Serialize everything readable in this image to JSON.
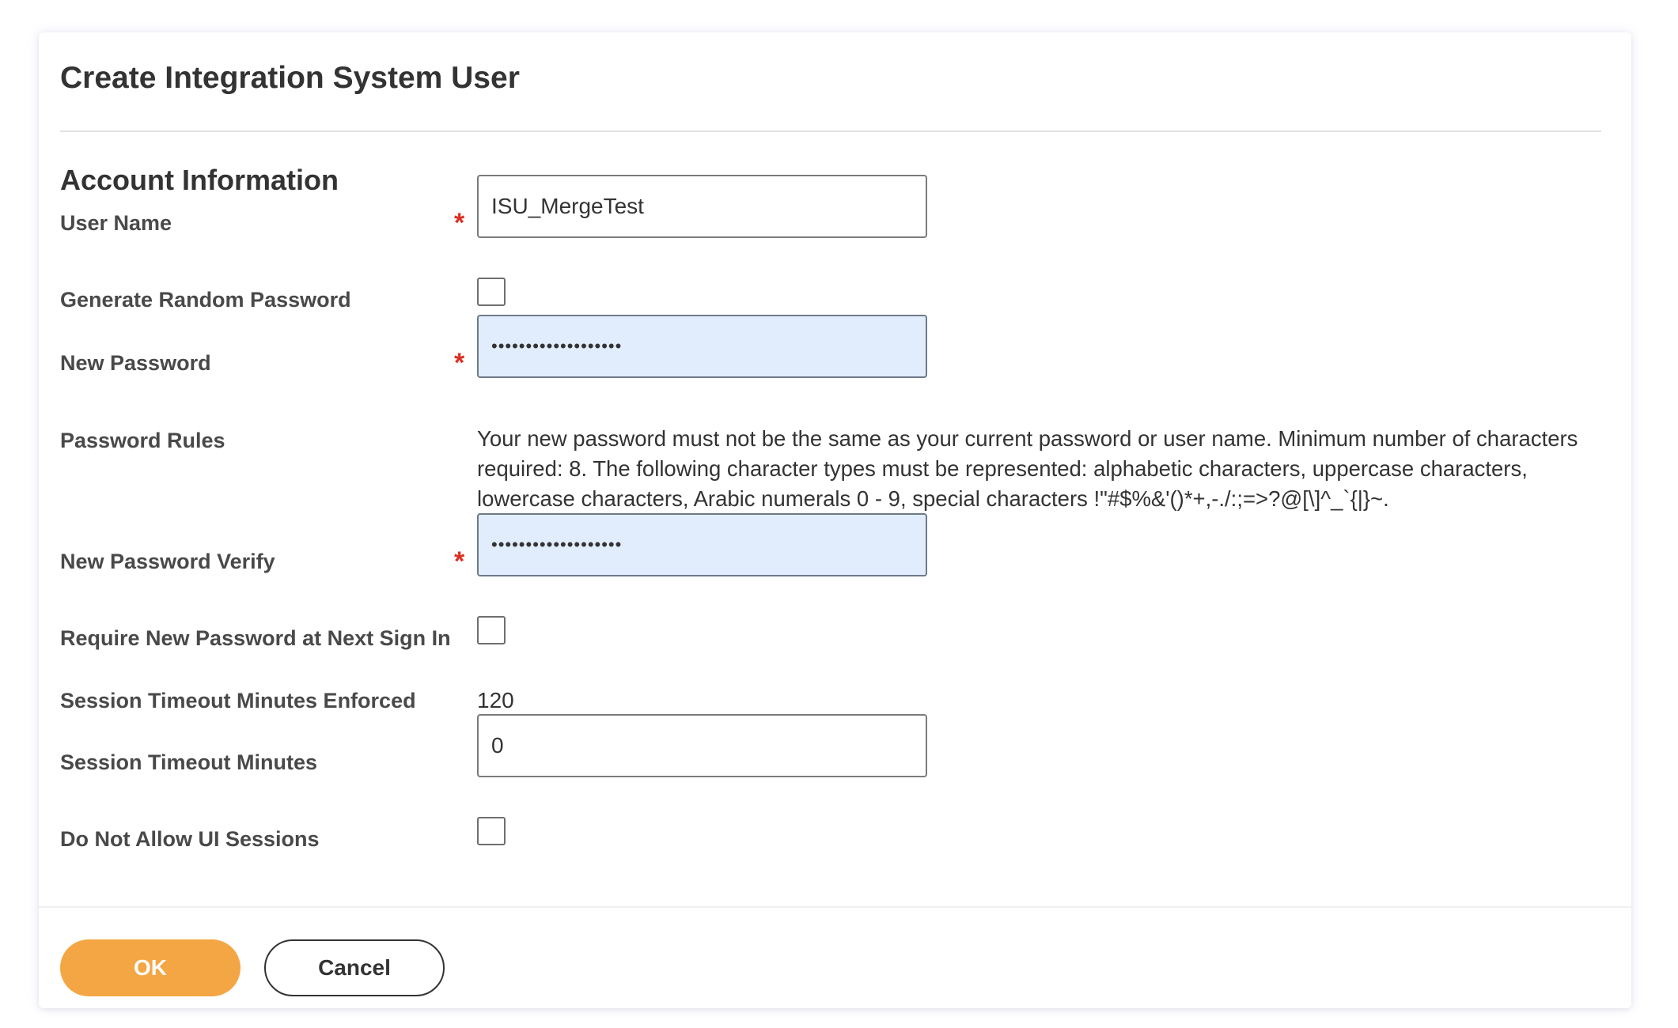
{
  "dialog": {
    "title": "Create Integration System User",
    "section_title": "Account Information"
  },
  "fields": {
    "user_name": {
      "label": "User Name",
      "required_mark": "*",
      "value": "ISU_MergeTest"
    },
    "generate_random_password": {
      "label": "Generate Random Password",
      "checked": false
    },
    "new_password": {
      "label": "New Password",
      "required_mark": "*",
      "value": "•••••••••••••••••••"
    },
    "password_rules": {
      "label": "Password Rules",
      "text": "Your new password must not be the same as your current password or user name. Minimum number of characters required: 8. The following character types must be represented: alphabetic characters, uppercase characters, lowercase characters, Arabic numerals 0 - 9, special characters !\"#$%&'()*+,-./:;=>?@[\\]^_`{|}~."
    },
    "new_password_verify": {
      "label": "New Password Verify",
      "required_mark": "*",
      "value": "•••••••••••••••••••"
    },
    "require_new_password": {
      "label": "Require New Password at Next Sign In",
      "checked": false
    },
    "session_timeout_enforced": {
      "label": "Session Timeout Minutes Enforced",
      "value": "120"
    },
    "session_timeout_minutes": {
      "label": "Session Timeout Minutes",
      "value": "0"
    },
    "do_not_allow_ui_sessions": {
      "label": "Do Not Allow UI Sessions",
      "checked": false
    }
  },
  "buttons": {
    "ok": "OK",
    "cancel": "Cancel"
  },
  "colors": {
    "primary_button": "#f4a644",
    "required": "#de2e21",
    "filled_input": "#e1edfd"
  }
}
